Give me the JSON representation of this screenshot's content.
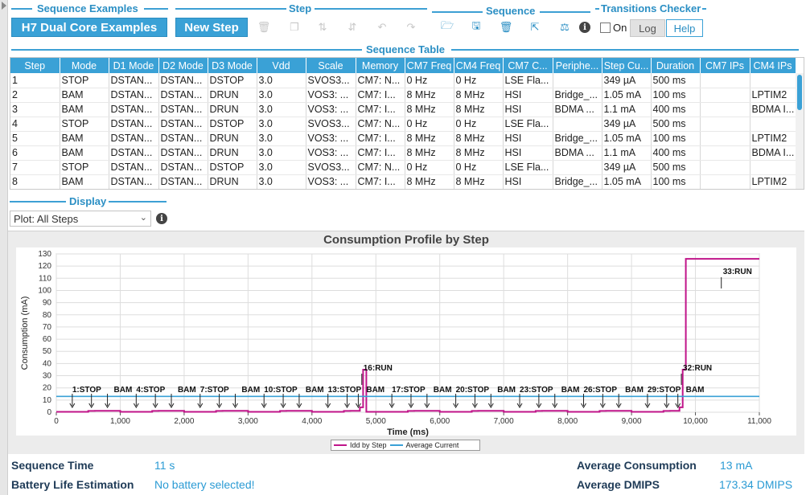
{
  "groups": {
    "sequence_examples": "Sequence Examples",
    "step": "Step",
    "sequence": "Sequence",
    "transitions_checker": "Transitions Checker",
    "sequence_table": "Sequence Table",
    "display": "Display"
  },
  "buttons": {
    "examples": "H7 Dual Core Examples",
    "new_step": "New Step",
    "on_label": "On",
    "log": "Log",
    "help": "Help"
  },
  "icons": {
    "step_toolbar": [
      "delete-icon",
      "duplicate-icon",
      "move-up-icon",
      "move-down-icon",
      "undo-icon",
      "redo-icon"
    ],
    "sequence_toolbar": [
      "open-folder-icon",
      "save-icon",
      "delete-icon",
      "export-icon",
      "compare-icon",
      "info-icon"
    ]
  },
  "table": {
    "columns": [
      "Step",
      "Mode",
      "D1 Mode",
      "D2 Mode",
      "D3 Mode",
      "Vdd",
      "Scale",
      "Memory",
      "CM7 Freq",
      "CM4 Freq",
      "CM7 C...",
      "Periphe...",
      "Step Cu...",
      "Duration",
      "CM7 IPs",
      "CM4 IPs"
    ],
    "rows": [
      [
        "1",
        "STOP",
        "DSTAN...",
        "DSTAN...",
        "DSTOP",
        "3.0",
        "SVOS3...",
        "CM7: N...",
        "0 Hz",
        "0 Hz",
        "LSE Fla...",
        "",
        "349 µA",
        "500 ms",
        "",
        ""
      ],
      [
        "2",
        "BAM",
        "DSTAN...",
        "DSTAN...",
        "DRUN",
        "3.0",
        "VOS3: ...",
        "CM7: I...",
        "8 MHz",
        "8 MHz",
        "HSI",
        "Bridge_...",
        "1.05 mA",
        "100 ms",
        "",
        "LPTIM2"
      ],
      [
        "3",
        "BAM",
        "DSTAN...",
        "DSTAN...",
        "DRUN",
        "3.0",
        "VOS3: ...",
        "CM7: I...",
        "8 MHz",
        "8 MHz",
        "HSI",
        "BDMA ...",
        "1.1 mA",
        "400 ms",
        "",
        "BDMA I..."
      ],
      [
        "4",
        "STOP",
        "DSTAN...",
        "DSTAN...",
        "DSTOP",
        "3.0",
        "SVOS3...",
        "CM7: N...",
        "0 Hz",
        "0 Hz",
        "LSE Fla...",
        "",
        "349 µA",
        "500 ms",
        "",
        ""
      ],
      [
        "5",
        "BAM",
        "DSTAN...",
        "DSTAN...",
        "DRUN",
        "3.0",
        "VOS3: ...",
        "CM7: I...",
        "8 MHz",
        "8 MHz",
        "HSI",
        "Bridge_...",
        "1.05 mA",
        "100 ms",
        "",
        "LPTIM2"
      ],
      [
        "6",
        "BAM",
        "DSTAN...",
        "DSTAN...",
        "DRUN",
        "3.0",
        "VOS3: ...",
        "CM7: I...",
        "8 MHz",
        "8 MHz",
        "HSI",
        "BDMA ...",
        "1.1 mA",
        "400 ms",
        "",
        "BDMA I..."
      ],
      [
        "7",
        "STOP",
        "DSTAN...",
        "DSTAN...",
        "DSTOP",
        "3.0",
        "SVOS3...",
        "CM7: N...",
        "0 Hz",
        "0 Hz",
        "LSE Fla...",
        "",
        "349 µA",
        "500 ms",
        "",
        ""
      ],
      [
        "8",
        "BAM",
        "DSTAN...",
        "DSTAN...",
        "DRUN",
        "3.0",
        "VOS3: ...",
        "CM7: I...",
        "8 MHz",
        "8 MHz",
        "HSI",
        "Bridge_...",
        "1.05 mA",
        "100 ms",
        "",
        "LPTIM2"
      ]
    ]
  },
  "display": {
    "plot_select": "Plot: All Steps"
  },
  "chart_data": {
    "type": "line",
    "title": "Consumption Profile by Step",
    "xlabel": "Time (ms)",
    "ylabel": "Consumption (mA)",
    "xlim": [
      0,
      11000
    ],
    "ylim": [
      0,
      130
    ],
    "xticks": [
      "0",
      "1,000",
      "2,000",
      "3,000",
      "4,000",
      "5,000",
      "6,000",
      "7,000",
      "8,000",
      "9,000",
      "10,000",
      "11,000"
    ],
    "yticks": [
      "0",
      "10",
      "20",
      "30",
      "40",
      "50",
      "60",
      "70",
      "80",
      "90",
      "100",
      "110",
      "120",
      "130"
    ],
    "series": [
      {
        "name": "Idd by Step",
        "color": "#c0158a",
        "x": [
          0,
          500,
          500,
          600,
          600,
          1000,
          1000,
          1500,
          1500,
          1600,
          1600,
          2000,
          2000,
          2500,
          2500,
          2600,
          2600,
          3000,
          3000,
          3500,
          3500,
          3600,
          3600,
          4000,
          4000,
          4500,
          4500,
          4600,
          4600,
          4750,
          4750,
          4800,
          4800,
          4850,
          4850,
          5000,
          5000,
          5500,
          5500,
          5600,
          5600,
          6000,
          6000,
          6500,
          6500,
          6600,
          6600,
          7000,
          7000,
          7500,
          7500,
          7600,
          7600,
          8000,
          8000,
          8500,
          8500,
          8600,
          8600,
          9000,
          9000,
          9500,
          9500,
          9600,
          9600,
          9750,
          9750,
          9800,
          9800,
          9850,
          9850,
          10000,
          10000,
          11000
        ],
        "y": [
          0.35,
          0.35,
          1.05,
          1.05,
          1.1,
          1.1,
          0.35,
          0.35,
          1.05,
          1.05,
          1.1,
          1.1,
          0.35,
          0.35,
          1.05,
          1.05,
          1.1,
          1.1,
          0.35,
          0.35,
          1.05,
          1.05,
          1.1,
          1.1,
          0.35,
          0.35,
          1.05,
          1.05,
          1.1,
          1.1,
          4,
          4,
          35,
          35,
          0.35,
          0.35,
          0.35,
          0.35,
          1.05,
          1.05,
          1.1,
          1.1,
          0.35,
          0.35,
          1.05,
          1.05,
          1.1,
          1.1,
          0.35,
          0.35,
          1.05,
          1.05,
          1.1,
          1.1,
          0.35,
          0.35,
          1.05,
          1.05,
          1.1,
          1.1,
          0.35,
          0.35,
          1.05,
          1.05,
          1.1,
          1.1,
          4,
          4,
          35,
          35,
          126,
          126,
          126,
          126
        ]
      },
      {
        "name": "Average Current",
        "color": "#3aa1d6",
        "x": [
          0,
          11000
        ],
        "y": [
          13,
          13
        ]
      }
    ],
    "annotations": [
      {
        "text": "16:RUN",
        "x": 4830,
        "y": 35
      },
      {
        "text": "32:RUN",
        "x": 9830,
        "y": 35
      },
      {
        "text": "33:RUN",
        "x": 10430,
        "y": 126
      },
      {
        "text": "1:STOP",
        "x": 250,
        "y": 13
      },
      {
        "text": "BAM",
        "x": 900,
        "y": 13
      },
      {
        "text": "4:STOP",
        "x": 1250,
        "y": 13
      },
      {
        "text": "BAM",
        "x": 1900,
        "y": 13
      },
      {
        "text": "7:STOP",
        "x": 2250,
        "y": 13
      },
      {
        "text": "BAM",
        "x": 2900,
        "y": 13
      },
      {
        "text": "10:STOP",
        "x": 3250,
        "y": 13
      },
      {
        "text": "BAM",
        "x": 3900,
        "y": 13
      },
      {
        "text": "13:STOP",
        "x": 4250,
        "y": 13
      },
      {
        "text": "BAM",
        "x": 4850,
        "y": 13
      },
      {
        "text": "17:STOP",
        "x": 5250,
        "y": 13
      },
      {
        "text": "BAM",
        "x": 5900,
        "y": 13
      },
      {
        "text": "20:STOP",
        "x": 6250,
        "y": 13
      },
      {
        "text": "BAM",
        "x": 6900,
        "y": 13
      },
      {
        "text": "23:STOP",
        "x": 7250,
        "y": 13
      },
      {
        "text": "BAM",
        "x": 7900,
        "y": 13
      },
      {
        "text": "26:STOP",
        "x": 8250,
        "y": 13
      },
      {
        "text": "BAM",
        "x": 8900,
        "y": 13
      },
      {
        "text": "29:STOP",
        "x": 9250,
        "y": 13
      },
      {
        "text": "BAM",
        "x": 9850,
        "y": 13
      }
    ],
    "arrow_times": [
      250,
      550,
      800,
      1250,
      1550,
      1800,
      2250,
      2550,
      2800,
      3250,
      3550,
      3800,
      4250,
      4550,
      4725,
      5250,
      5550,
      5800,
      6250,
      6550,
      6800,
      7250,
      7550,
      7800,
      8250,
      8550,
      8800,
      9250,
      9550,
      9725
    ],
    "grid": true,
    "legend_position": "bottom-center"
  },
  "footer": {
    "sequence_time_label": "Sequence Time",
    "sequence_time_value": "11 s",
    "battery_label": "Battery Life Estimation",
    "battery_value": "No battery selected!",
    "avg_consumption_label": "Average Consumption",
    "avg_consumption_value": "13 mA",
    "avg_dmips_label": "Average DMIPS",
    "avg_dmips_value": "173.34 DMIPS"
  }
}
